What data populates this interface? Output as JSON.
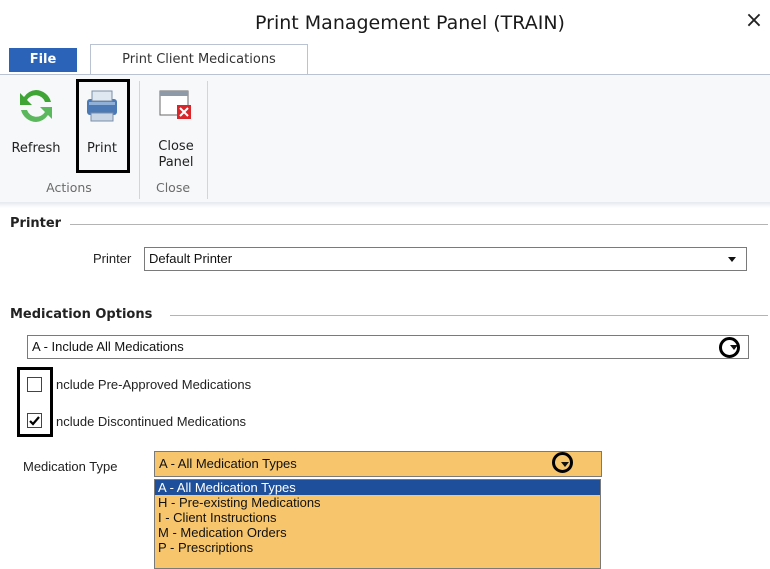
{
  "window": {
    "title": "Print Management Panel (TRAIN)",
    "close_glyph": "×"
  },
  "tabs": {
    "file": "File",
    "active": "Print Client Medications"
  },
  "ribbon": {
    "refresh_label": "Refresh",
    "print_label": "Print",
    "close_panel_label_1": "Close",
    "close_panel_label_2": "Panel",
    "group_actions": "Actions",
    "group_close": "Close",
    "icons": [
      "refresh-icon",
      "printer-icon",
      "close-panel-icon"
    ]
  },
  "printer_section": {
    "heading": "Printer",
    "printer_label": "Printer",
    "printer_value": "Default Printer"
  },
  "medication_section": {
    "heading": "Medication Options",
    "include_value": "A - Include All Medications",
    "chk_pre_approved_label": "nclude Pre-Approved Medications",
    "chk_pre_approved_checked": false,
    "chk_discontinued_label": "nclude Discontinued Medications",
    "chk_discontinued_checked": true,
    "type_label": "Medication Type",
    "type_value": "A - All Medication Types",
    "type_options": [
      "A - All Medication Types",
      "H - Pre-existing Medications",
      "I - Client Instructions",
      "M - Medication Orders",
      "P - Prescriptions"
    ],
    "type_selected_index": 0
  },
  "colors": {
    "file_tab": "#2b63b9",
    "dropdown_highlight": "#f7c56b",
    "selected_option": "#1e4f9a"
  }
}
